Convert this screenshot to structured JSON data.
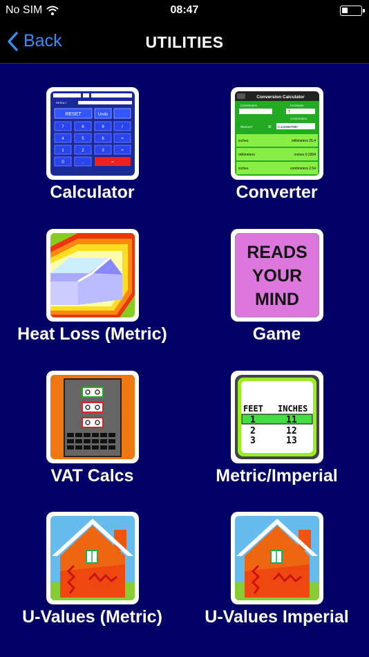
{
  "status": {
    "carrier": "No SIM",
    "time": "08:47"
  },
  "nav": {
    "back_label": "Back",
    "title": "UTILITIES"
  },
  "tiles": [
    {
      "label": "Calculator"
    },
    {
      "label": "Converter"
    },
    {
      "label": "Heat Loss (Metric)"
    },
    {
      "label": "Game"
    },
    {
      "label": "VAT Calcs"
    },
    {
      "label": "Metric/Imperial"
    },
    {
      "label": "U-Values (Metric)"
    },
    {
      "label": "U-Values Imperial"
    }
  ],
  "calculator_icon": {
    "result": "RESULT",
    "reset": "RESET",
    "undo": "Undo"
  },
  "converter_icon": {
    "title": "Conversion Calculator",
    "h1": "Centimeters",
    "h2": "Increases",
    "value": "7",
    "h3": "Centimeters",
    "result": "RESULT",
    "result_value": "0.1234567890",
    "rows": [
      {
        "a": "inches",
        "b": "millimeters 25.4"
      },
      {
        "a": "millimeters",
        "b": "inches 0.3394"
      },
      {
        "a": "inches",
        "b": "centimeters 2.54"
      }
    ]
  },
  "game_icon": {
    "line1": "READS",
    "line2": "YOUR",
    "line3": "MIND"
  },
  "metric_icon": {
    "feet": "FEET",
    "inches": "INCHES",
    "rows": [
      [
        "1",
        "11"
      ],
      [
        "2",
        "12"
      ],
      [
        "3",
        "13"
      ]
    ]
  },
  "colors": {
    "background": "#000066",
    "bars": "#000000",
    "accent": "#3a8df5"
  }
}
